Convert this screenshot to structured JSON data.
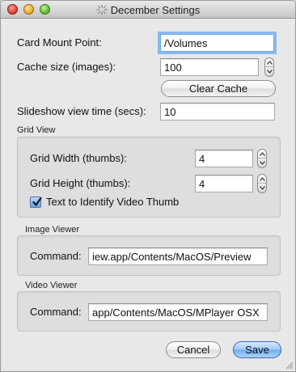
{
  "window": {
    "title": "December Settings",
    "title_icon": "gear-icon",
    "controls": [
      "close-icon",
      "minimize-icon",
      "zoom-icon"
    ]
  },
  "general": {
    "card_mount_label": "Card Mount Point:",
    "card_mount_value": "/Volumes",
    "cache_size_label": "Cache size (images):",
    "cache_size_value": "100",
    "clear_cache_label": "Clear Cache",
    "slideshow_label": "Slideshow view time (secs):",
    "slideshow_value": "10"
  },
  "grid_view": {
    "title": "Grid View",
    "width_label": "Grid Width (thumbs):",
    "width_value": "4",
    "height_label": "Grid Height (thumbs):",
    "height_value": "4",
    "video_thumb_label": "Text to Identify Video Thumb",
    "video_thumb_checked": true
  },
  "image_viewer": {
    "title": "Image Viewer",
    "command_label": "Command:",
    "command_value": "iew.app/Contents/MacOS/Preview"
  },
  "video_viewer": {
    "title": "Video Viewer",
    "command_label": "Command:",
    "command_value": "app/Contents/MacOS/MPlayer OSX"
  },
  "footer": {
    "cancel_label": "Cancel",
    "save_label": "Save"
  },
  "colors": {
    "focus_ring": "#8cb9ee",
    "default_button": "#71acef",
    "window_bg": "#e8e8e8"
  }
}
